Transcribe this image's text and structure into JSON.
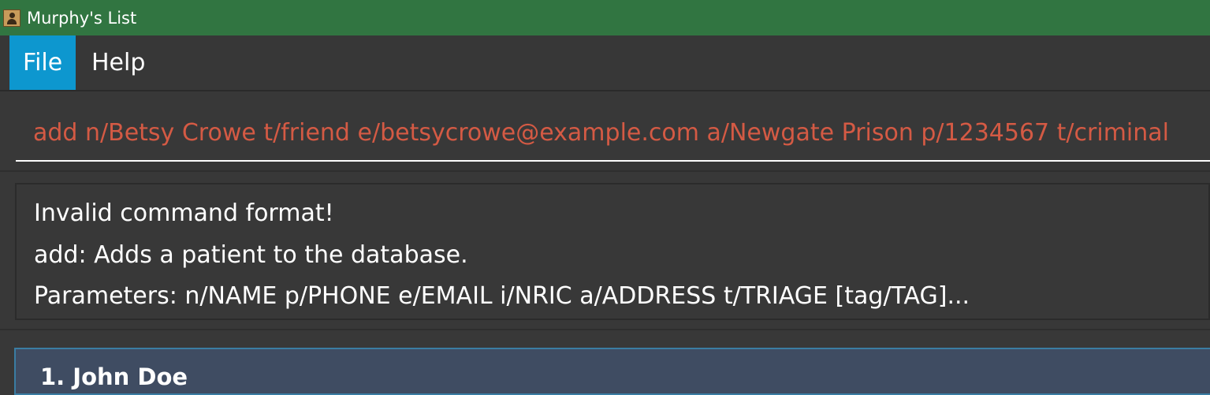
{
  "window": {
    "title": "Murphy's List",
    "icon": "address-book-icon"
  },
  "menu": {
    "file_label": "File",
    "help_label": "Help"
  },
  "command": {
    "value": "add n/Betsy Crowe t/friend e/betsycrowe@example.com a/Newgate Prison p/1234567 t/criminal"
  },
  "result": {
    "line1": "Invalid command format!",
    "line2": "add: Adds a patient to the database.",
    "line3": "Parameters: n/NAME p/PHONE e/EMAIL i/NRIC a/ADDRESS t/TRIAGE [tag/TAG]..."
  },
  "persons": [
    {
      "name": "1. John Doe"
    }
  ],
  "colors": {
    "titlebar": "#317541",
    "menu_selected": "#0d97cf",
    "error_text": "#d45a44",
    "background": "#383838",
    "card": "#3f4c62"
  }
}
